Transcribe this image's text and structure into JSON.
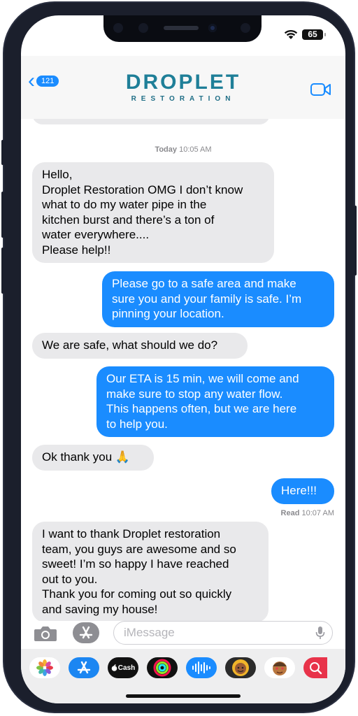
{
  "status_bar": {
    "battery": "65"
  },
  "header": {
    "back_count": "121",
    "logo_main": "DROPLET",
    "logo_sub": "RESTORATION"
  },
  "conversation": {
    "timestamp_day": "Today",
    "timestamp_time": "10:05 AM",
    "messages": [
      {
        "side": "in",
        "text": "Hello,\nDroplet Restoration OMG I don’t know\nwhat to do my water pipe in the\nkitchen burst and there’s a ton of\nwater everywhere....\nPlease help!!"
      },
      {
        "side": "out",
        "text": "Please go to a safe area and make\nsure you and your family is safe. I’m\npinning your location."
      },
      {
        "side": "in",
        "text": "We are safe, what should we do?"
      },
      {
        "side": "out",
        "text": "Our ETA is 15 min, we will come and\nmake sure to stop any water flow.\nThis happens often, but we are here\nto help you."
      },
      {
        "side": "in",
        "text": "Ok thank you 🙏"
      },
      {
        "side": "out",
        "text": "Here!!!"
      },
      {
        "side": "in",
        "text": "I want to thank Droplet restoration\nteam, you guys are awesome and so\nsweet! I’m so happy I have reached\nout to you.\nThank you for coming out so quickly\nand saving my house!"
      }
    ],
    "read_label": "Read",
    "read_time": "10:07 AM"
  },
  "compose": {
    "placeholder": "iMessage"
  },
  "app_drawer": {
    "items": [
      "photos-app",
      "app-store-app",
      "apple-cash-app",
      "activity-app",
      "audio-message-app",
      "memoji-stickers-app",
      "memoji-stickers-app-2",
      "web-images-app"
    ],
    "cash_label": "Cash"
  },
  "colors": {
    "blue_bubble": "#1a8cff",
    "gray_bubble": "#e9e9eb",
    "brand": "#1f7f98",
    "frame": "#1b1f2c"
  }
}
